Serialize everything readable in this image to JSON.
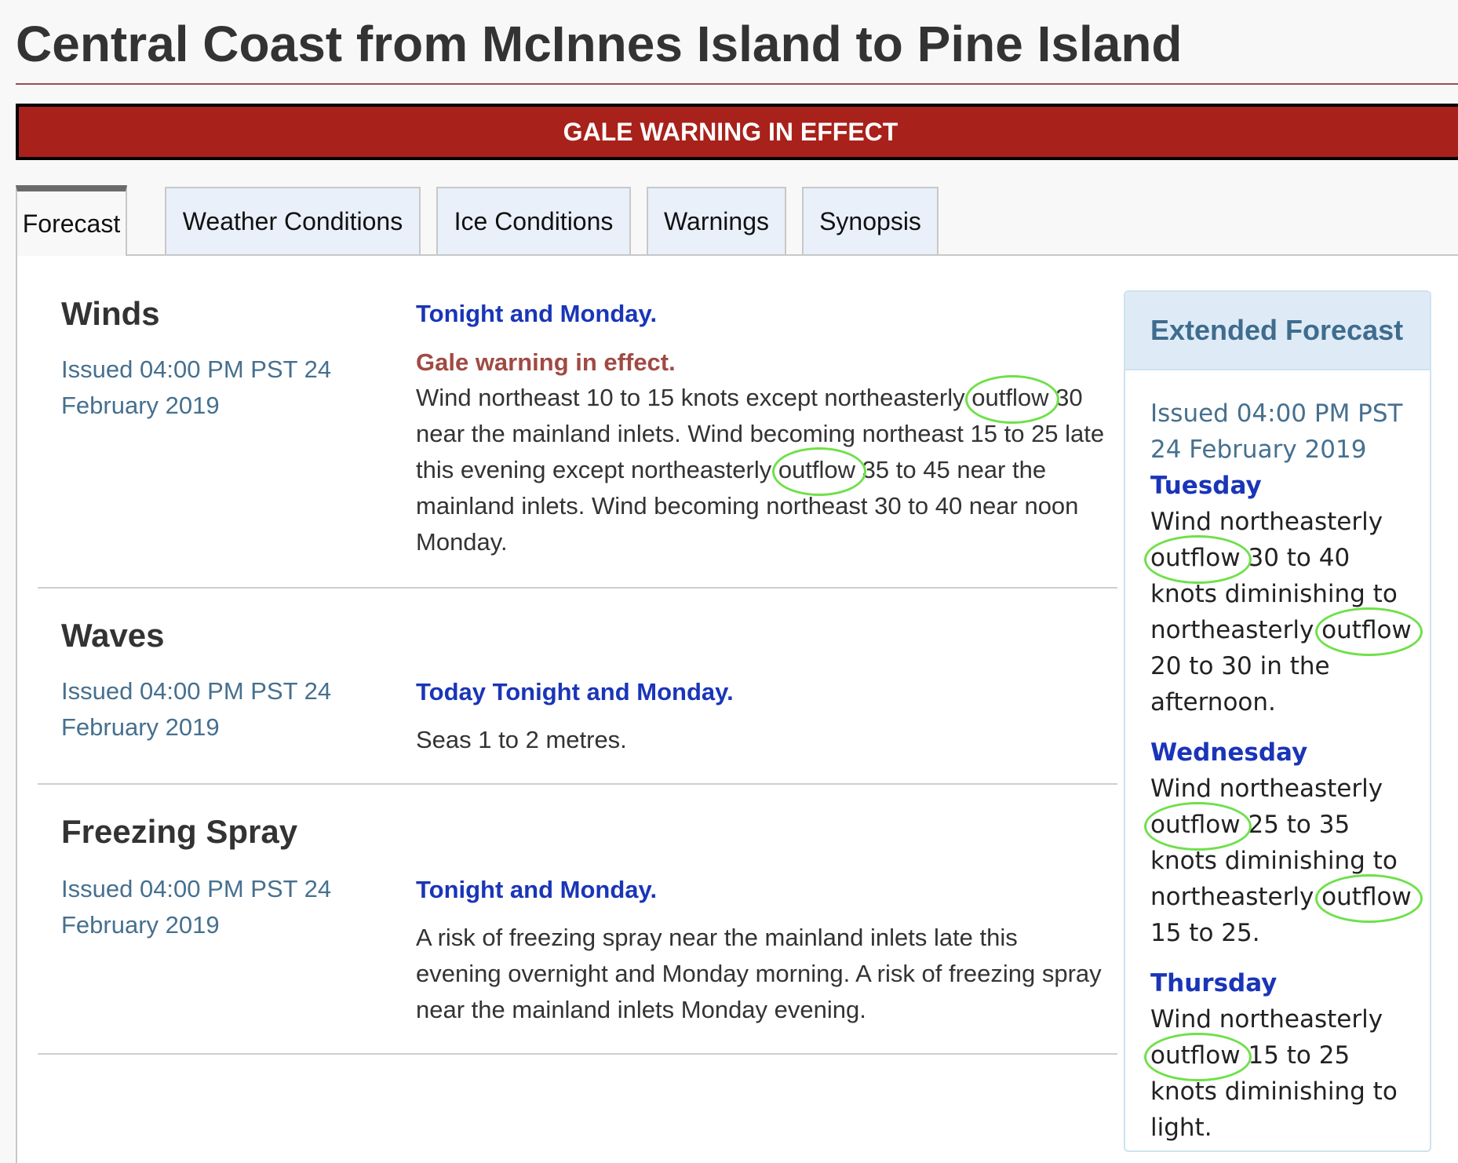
{
  "header": {
    "title": "Central Coast from McInnes Island to Pine Island"
  },
  "banner": {
    "text": "GALE WARNING IN EFFECT",
    "colors": {
      "background": "#a8211a",
      "border": "#000000",
      "text": "#ffffff"
    }
  },
  "tabs": [
    {
      "label": "Forecast",
      "active": true
    },
    {
      "label": "Weather Conditions",
      "active": false
    },
    {
      "label": "Ice Conditions",
      "active": false
    },
    {
      "label": "Warnings",
      "active": false
    },
    {
      "label": "Synopsis",
      "active": false
    }
  ],
  "sections": {
    "winds": {
      "heading": "Winds",
      "issued": "Issued 04:00 PM PST 24 February 2019",
      "period": "Tonight and Monday.",
      "alert": "Gale warning in effect.",
      "text_parts": [
        "Wind northeast 10 to 15 knots except northeasterly ",
        "outflow",
        " 30 near the mainland inlets. Wind becoming northeast 15 to 25 late this evening except northeasterly ",
        "outflow",
        " 35 to 45 near the mainland inlets. Wind becoming northeast 30 to 40 near noon Monday."
      ]
    },
    "waves": {
      "heading": "Waves",
      "issued": "Issued 04:00 PM PST 24 February 2019",
      "period": "Today Tonight and Monday.",
      "text": "Seas 1 to 2 metres."
    },
    "freezing_spray": {
      "heading": "Freezing Spray",
      "issued": "Issued 04:00 PM PST 24 February 2019",
      "period": "Tonight and Monday.",
      "text": "A risk of freezing spray near the mainland inlets late this evening overnight and Monday morning. A risk of freezing spray near the mainland inlets Monday evening."
    }
  },
  "extended": {
    "title": "Extended Forecast",
    "issued": "Issued 04:00 PM PST 24 February 2019",
    "days": [
      {
        "day": "Tuesday",
        "parts": [
          "Wind northeasterly ",
          "outflow",
          " 30 to 40 knots diminishing to northeasterly ",
          "outflow",
          " 20 to 30 in the afternoon."
        ]
      },
      {
        "day": "Wednesday",
        "parts": [
          "Wind northeasterly ",
          "outflow",
          " 25 to 35 knots diminishing to northeasterly ",
          "outflow",
          " 15 to 25."
        ]
      },
      {
        "day": "Thursday",
        "parts": [
          "Wind northeasterly ",
          "outflow",
          " 15 to 25 knots diminishing to light."
        ]
      }
    ]
  },
  "annotation": {
    "highlight_word": "outflow",
    "highlight_color": "#6fe04a"
  },
  "colors": {
    "title": "#333333",
    "period_blue": "#1a35b8",
    "issued_blue": "#46708f",
    "alert_red": "#a04a44",
    "tab_bg": "#e9f0fa",
    "extended_header_bg": "#deebf6"
  }
}
